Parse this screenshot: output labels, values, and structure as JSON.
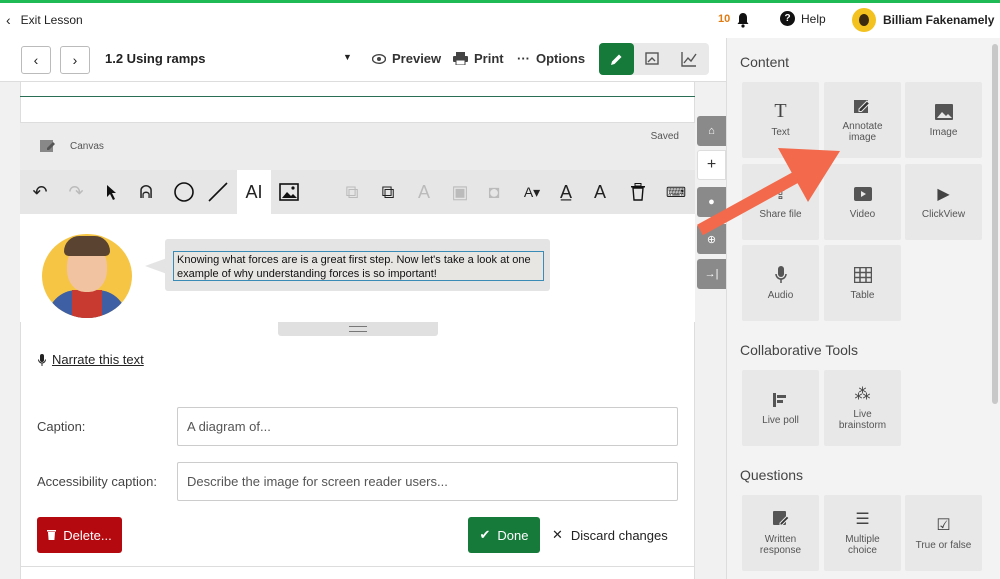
{
  "header": {
    "exit_label": "Exit Lesson",
    "notif_count": "10",
    "help_label": "Help",
    "user_name": "Billiam Fakenamely"
  },
  "toolbar": {
    "lesson_title": "1.2 Using ramps",
    "preview_label": "Preview",
    "print_label": "Print",
    "options_label": "Options"
  },
  "canvas": {
    "label": "Canvas",
    "status": "Saved",
    "speech_text": "Knowing what forces are is a great first step. Now let's take a look at one example of why understanding forces is so important!"
  },
  "form": {
    "narrate_label": "Narrate this text",
    "caption_label": "Caption:",
    "caption_placeholder": "A diagram of...",
    "access_label": "Accessibility caption:",
    "access_placeholder": "Describe the image for screen reader users...",
    "delete_label": "Delete...",
    "done_label": "Done",
    "discard_label": "Discard changes"
  },
  "panel": {
    "content_heading": "Content",
    "content_items": [
      {
        "label": "Text",
        "icon": "text-icon"
      },
      {
        "label": "Annotate image",
        "icon": "annotate-image-icon"
      },
      {
        "label": "Image",
        "icon": "image-icon"
      },
      {
        "label": "Share file",
        "icon": "share-file-icon"
      },
      {
        "label": "Video",
        "icon": "video-icon"
      },
      {
        "label": "ClickView",
        "icon": "clickview-icon"
      },
      {
        "label": "Audio",
        "icon": "microphone-icon"
      },
      {
        "label": "Table",
        "icon": "table-icon"
      }
    ],
    "collab_heading": "Collaborative Tools",
    "collab_items": [
      {
        "label": "Live poll",
        "icon": "poll-icon"
      },
      {
        "label": "Live brainstorm",
        "icon": "brainstorm-icon"
      }
    ],
    "questions_heading": "Questions",
    "question_items": [
      {
        "label": "Written response",
        "icon": "written-response-icon"
      },
      {
        "label": "Multiple choice",
        "icon": "multiple-choice-icon"
      },
      {
        "label": "True or false",
        "icon": "true-false-icon"
      }
    ]
  },
  "colors": {
    "accent_green": "#157a3a",
    "delete_red": "#b3090f",
    "arrow_orange": "#f26a4b",
    "top_border": "#1fba55"
  }
}
